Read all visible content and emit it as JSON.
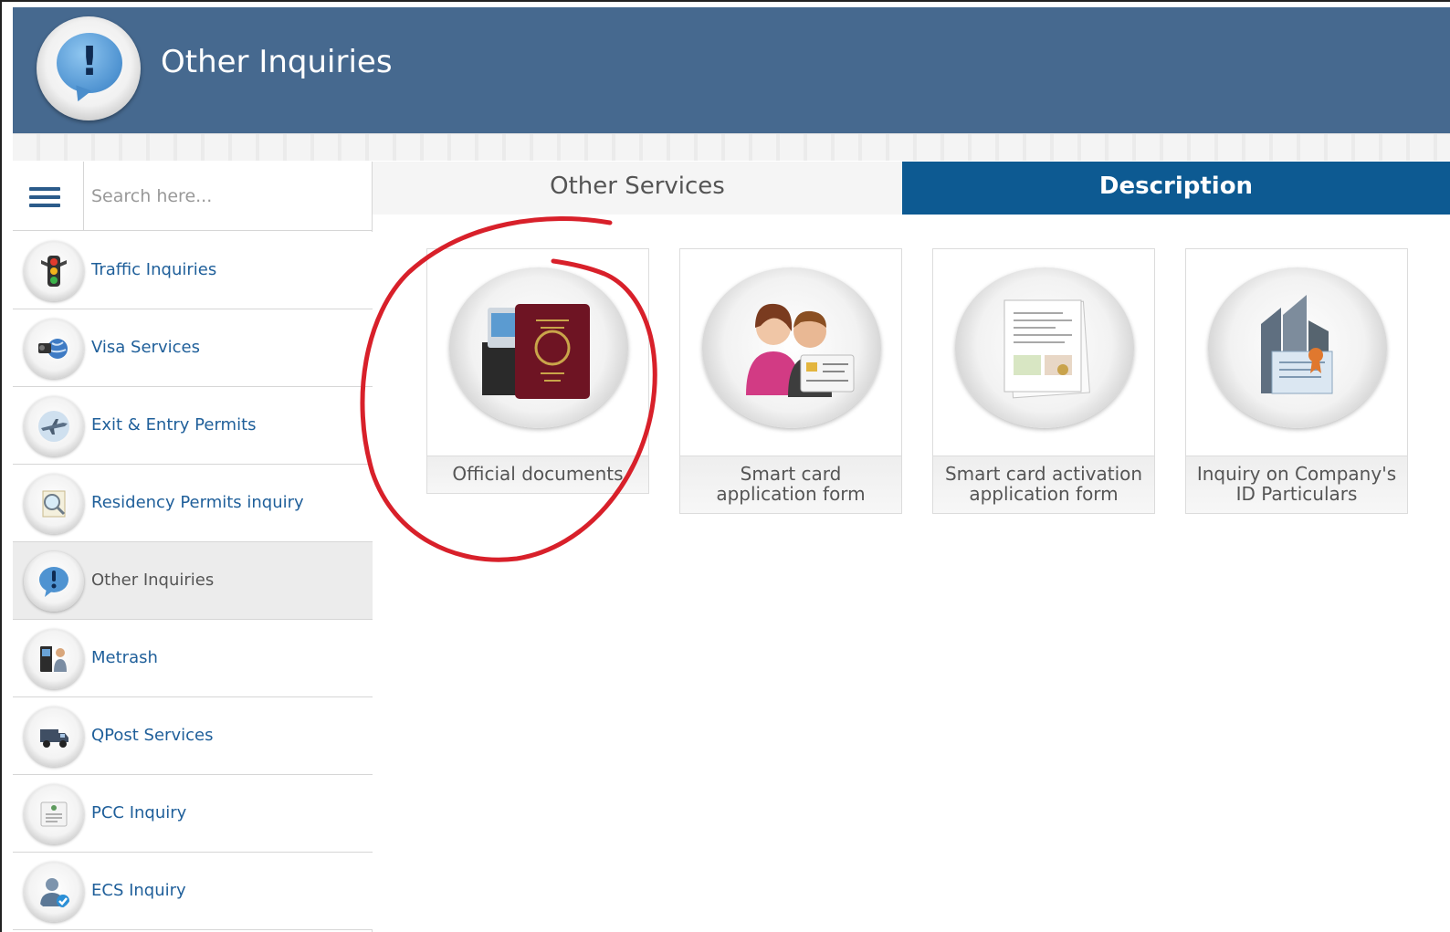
{
  "header": {
    "title": "Other Inquiries",
    "icon": "exclamation-bubble-icon"
  },
  "search": {
    "placeholder": "Search here..."
  },
  "sidebar": {
    "items": [
      {
        "label": "Traffic Inquiries",
        "icon": "traffic-light-icon"
      },
      {
        "label": "Visa Services",
        "icon": "visa-globe-icon"
      },
      {
        "label": "Exit & Entry Permits",
        "icon": "airplane-icon"
      },
      {
        "label": "Residency Permits inquiry",
        "icon": "magnifier-document-icon"
      },
      {
        "label": "Other Inquiries",
        "icon": "exclamation-bubble-icon",
        "active": true
      },
      {
        "label": "Metrash",
        "icon": "kiosk-icon"
      },
      {
        "label": "QPost Services",
        "icon": "delivery-truck-icon"
      },
      {
        "label": "PCC Inquiry",
        "icon": "certificate-icon"
      },
      {
        "label": "ECS Inquiry",
        "icon": "person-check-icon"
      }
    ]
  },
  "tabs": {
    "other_services": "Other Services",
    "description": "Description"
  },
  "services": [
    {
      "lines": [
        "Official documents"
      ],
      "icon": "passport-icon"
    },
    {
      "lines": [
        "Smart card",
        "application form"
      ],
      "icon": "people-id-card-icon"
    },
    {
      "lines": [
        "Smart card activation",
        "application form"
      ],
      "icon": "application-form-icon"
    },
    {
      "lines": [
        "Inquiry on Company's",
        "ID Particulars"
      ],
      "icon": "company-building-icon"
    }
  ],
  "colors": {
    "header": "#46698f",
    "active_tab": "#0d5a92",
    "link": "#1f5f9a",
    "annotation": "#d8202a"
  }
}
